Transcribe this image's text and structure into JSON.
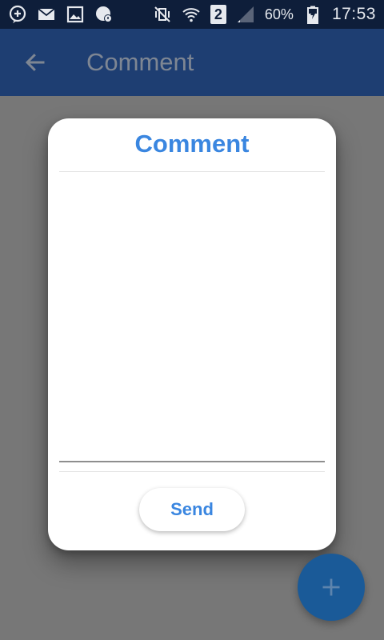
{
  "status_bar": {
    "battery_percent": "60%",
    "time": "17:53",
    "sim_slot": "2",
    "left_icons": [
      "chat-plus-icon",
      "mail-icon",
      "image-icon",
      "whatsapp-icon"
    ],
    "right_icons": [
      "mute-vibrate-icon",
      "wifi-icon",
      "sim-badge",
      "signal-icon",
      "battery-charging-icon"
    ]
  },
  "app_bar": {
    "title": "Comment",
    "back_icon": "arrow-left-icon"
  },
  "dialog": {
    "title": "Comment",
    "comment_value": "",
    "send_label": "Send"
  },
  "fab": {
    "icon": "plus-icon"
  },
  "colors": {
    "accent": "#3a86e0",
    "app_bar": "#1e3e72",
    "status_bar": "#0e1e3a",
    "scrim": "#777777"
  }
}
